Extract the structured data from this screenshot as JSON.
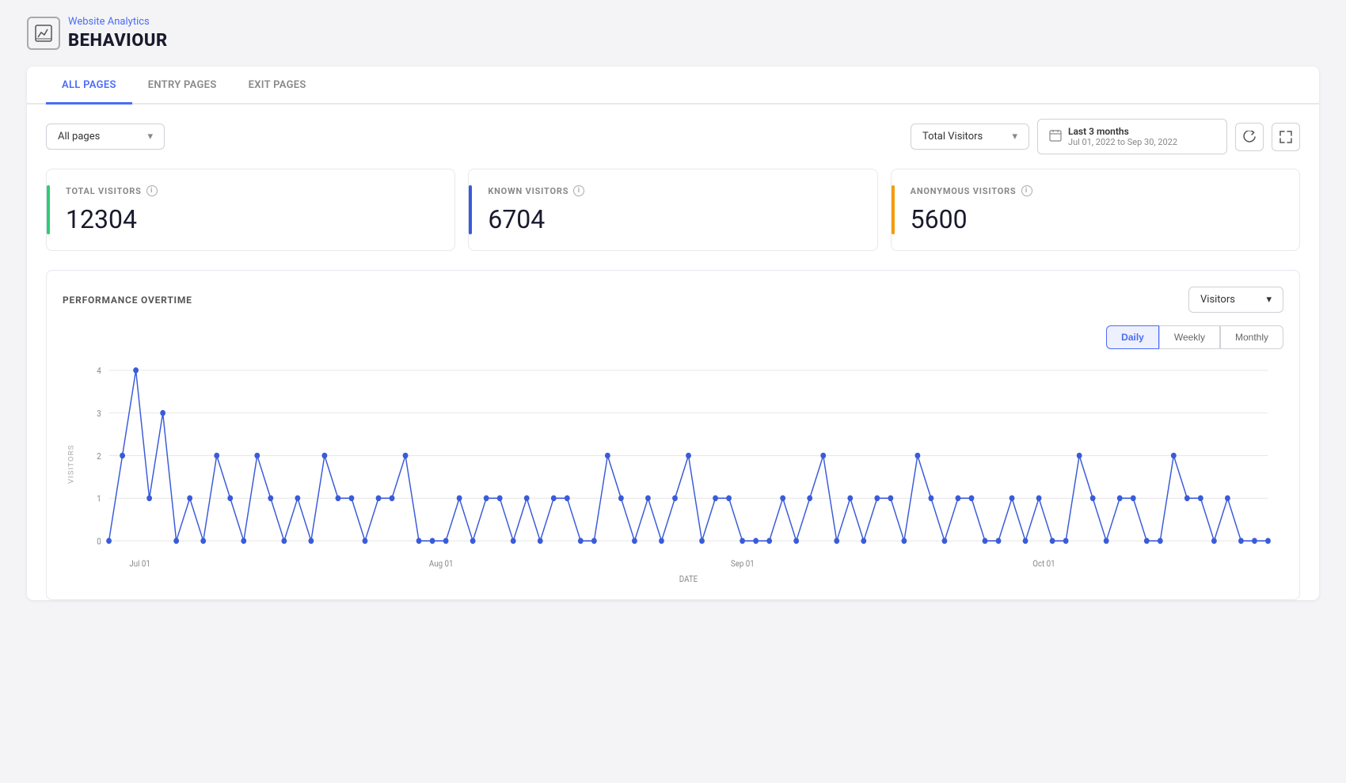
{
  "app": {
    "breadcrumb": "Website Analytics",
    "title": "BEHAVIOUR"
  },
  "tabs": [
    {
      "id": "all-pages",
      "label": "ALL PAGES",
      "active": true
    },
    {
      "id": "entry-pages",
      "label": "ENTRY PAGES",
      "active": false
    },
    {
      "id": "exit-pages",
      "label": "EXIT PAGES",
      "active": false
    }
  ],
  "toolbar": {
    "pages_filter": "All pages",
    "pages_filter_placeholder": "All pages",
    "metric_filter": "Total Visitors",
    "date_range_label": "Last 3 months",
    "date_from": "Jul 01, 2022",
    "date_to": "Sep 30, 2022",
    "date_separator": "to"
  },
  "metrics": [
    {
      "id": "total-visitors",
      "label": "TOTAL VISITORS",
      "value": "12304",
      "accent_color": "#2ecc71"
    },
    {
      "id": "known-visitors",
      "label": "KNOWN VISITORS",
      "value": "6704",
      "accent_color": "#3a5bd9"
    },
    {
      "id": "anonymous-visitors",
      "label": "ANONYMOUS VISITORS",
      "value": "5600",
      "accent_color": "#f39c12"
    }
  ],
  "chart": {
    "title": "PERFORMANCE OVERTIME",
    "metric_dropdown": "Visitors",
    "period_buttons": [
      "Daily",
      "Weekly",
      "Monthly"
    ],
    "active_period": "Daily",
    "y_axis_label": "VISITORS",
    "x_axis_label": "DATE",
    "x_ticks": [
      "Jul 01",
      "Aug 01",
      "Sep 01",
      "Oct 01"
    ],
    "y_ticks": [
      "0",
      "1",
      "2",
      "3",
      "4"
    ],
    "data_points": [
      {
        "x": 0,
        "y": 0
      },
      {
        "x": 1,
        "y": 2
      },
      {
        "x": 2,
        "y": 4
      },
      {
        "x": 3,
        "y": 1
      },
      {
        "x": 4,
        "y": 3
      },
      {
        "x": 5,
        "y": 0
      },
      {
        "x": 6,
        "y": 1
      },
      {
        "x": 7,
        "y": 0
      },
      {
        "x": 8,
        "y": 2
      },
      {
        "x": 9,
        "y": 1
      },
      {
        "x": 10,
        "y": 0
      },
      {
        "x": 11,
        "y": 2
      },
      {
        "x": 12,
        "y": 1
      },
      {
        "x": 13,
        "y": 0
      },
      {
        "x": 14,
        "y": 1
      },
      {
        "x": 15,
        "y": 0
      },
      {
        "x": 16,
        "y": 2
      },
      {
        "x": 17,
        "y": 1
      },
      {
        "x": 18,
        "y": 1
      },
      {
        "x": 19,
        "y": 0
      },
      {
        "x": 20,
        "y": 1
      },
      {
        "x": 21,
        "y": 1
      },
      {
        "x": 22,
        "y": 2
      },
      {
        "x": 23,
        "y": 0
      },
      {
        "x": 24,
        "y": 0
      },
      {
        "x": 25,
        "y": 0
      },
      {
        "x": 26,
        "y": 1
      },
      {
        "x": 27,
        "y": 0
      },
      {
        "x": 28,
        "y": 1
      },
      {
        "x": 29,
        "y": 1
      },
      {
        "x": 30,
        "y": 0
      },
      {
        "x": 31,
        "y": 1
      },
      {
        "x": 32,
        "y": 0
      },
      {
        "x": 33,
        "y": 1
      },
      {
        "x": 34,
        "y": 1
      },
      {
        "x": 35,
        "y": 0
      },
      {
        "x": 36,
        "y": 0
      },
      {
        "x": 37,
        "y": 2
      },
      {
        "x": 38,
        "y": 1
      },
      {
        "x": 39,
        "y": 0
      },
      {
        "x": 40,
        "y": 1
      },
      {
        "x": 41,
        "y": 0
      },
      {
        "x": 42,
        "y": 1
      },
      {
        "x": 43,
        "y": 2
      },
      {
        "x": 44,
        "y": 0
      },
      {
        "x": 45,
        "y": 1
      },
      {
        "x": 46,
        "y": 1
      },
      {
        "x": 47,
        "y": 0
      },
      {
        "x": 48,
        "y": 0
      },
      {
        "x": 49,
        "y": 0
      },
      {
        "x": 50,
        "y": 1
      },
      {
        "x": 51,
        "y": 0
      },
      {
        "x": 52,
        "y": 1
      },
      {
        "x": 53,
        "y": 2
      },
      {
        "x": 54,
        "y": 0
      },
      {
        "x": 55,
        "y": 1
      },
      {
        "x": 56,
        "y": 0
      },
      {
        "x": 57,
        "y": 1
      },
      {
        "x": 58,
        "y": 1
      },
      {
        "x": 59,
        "y": 0
      },
      {
        "x": 60,
        "y": 2
      },
      {
        "x": 61,
        "y": 1
      },
      {
        "x": 62,
        "y": 0
      },
      {
        "x": 63,
        "y": 1
      },
      {
        "x": 64,
        "y": 1
      },
      {
        "x": 65,
        "y": 0
      },
      {
        "x": 66,
        "y": 0
      },
      {
        "x": 67,
        "y": 1
      },
      {
        "x": 68,
        "y": 0
      },
      {
        "x": 69,
        "y": 1
      },
      {
        "x": 70,
        "y": 0
      },
      {
        "x": 71,
        "y": 0
      },
      {
        "x": 72,
        "y": 2
      },
      {
        "x": 73,
        "y": 1
      },
      {
        "x": 74,
        "y": 0
      },
      {
        "x": 75,
        "y": 1
      },
      {
        "x": 76,
        "y": 1
      },
      {
        "x": 77,
        "y": 0
      },
      {
        "x": 78,
        "y": 0
      },
      {
        "x": 79,
        "y": 2
      },
      {
        "x": 80,
        "y": 1
      },
      {
        "x": 81,
        "y": 1
      },
      {
        "x": 82,
        "y": 0
      },
      {
        "x": 83,
        "y": 1
      },
      {
        "x": 84,
        "y": 0
      },
      {
        "x": 85,
        "y": 0
      },
      {
        "x": 86,
        "y": 0
      }
    ]
  }
}
